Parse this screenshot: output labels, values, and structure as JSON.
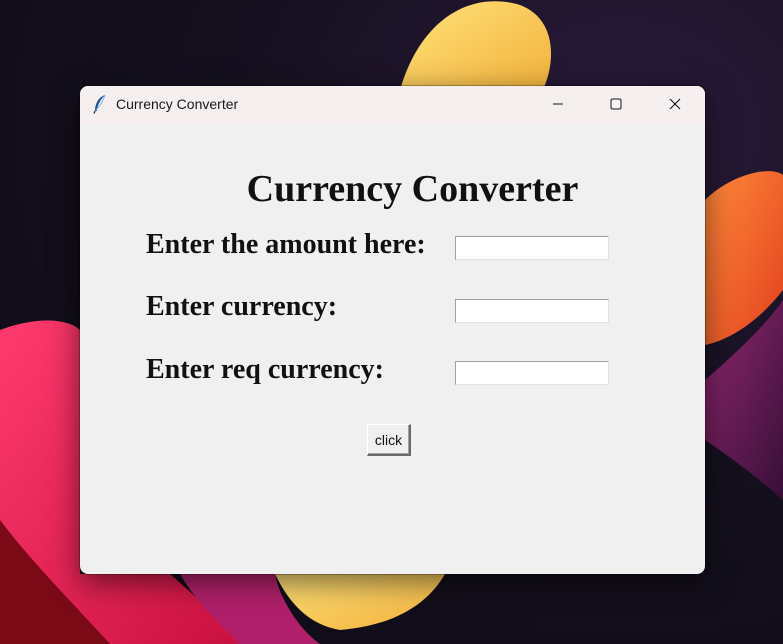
{
  "window": {
    "title": "Currency Converter",
    "controls": {
      "minimize_icon": "minimize-icon",
      "maximize_icon": "maximize-icon",
      "close_icon": "close-icon"
    }
  },
  "app_icon": "feather-icon",
  "form": {
    "heading": "Currency Converter",
    "amount_label": "Enter the amount here:",
    "amount_value": "",
    "currency_label": "Enter currency:",
    "currency_value": "",
    "req_currency_label": "Enter req currency:",
    "req_currency_value": "",
    "button_label": "click"
  },
  "colors": {
    "window_bg": "#f0f0f0",
    "titlebar_bg": "#f6eff0",
    "text": "#111111"
  }
}
